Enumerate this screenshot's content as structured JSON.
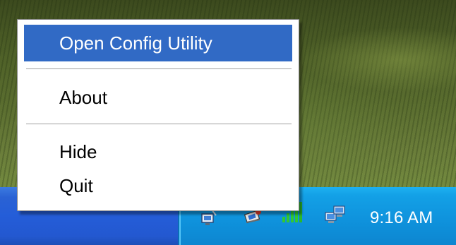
{
  "context_menu": {
    "items": [
      {
        "label": "Open Config Utility",
        "highlighted": true
      },
      {
        "label": "About",
        "highlighted": false
      },
      {
        "label": "Hide",
        "highlighted": false
      },
      {
        "label": "Quit",
        "highlighted": false
      }
    ]
  },
  "taskbar": {
    "tray": {
      "icons": [
        "network-status-icon",
        "network-activity-icon",
        "wireless-signal-icon",
        "network-connection-icon"
      ],
      "clock": "9:16 AM"
    }
  },
  "colors": {
    "menu_highlight": "#316ac5",
    "taskbar_blue": "#245dd8",
    "tray_blue": "#0f93dd",
    "signal_green": "#32c832"
  }
}
